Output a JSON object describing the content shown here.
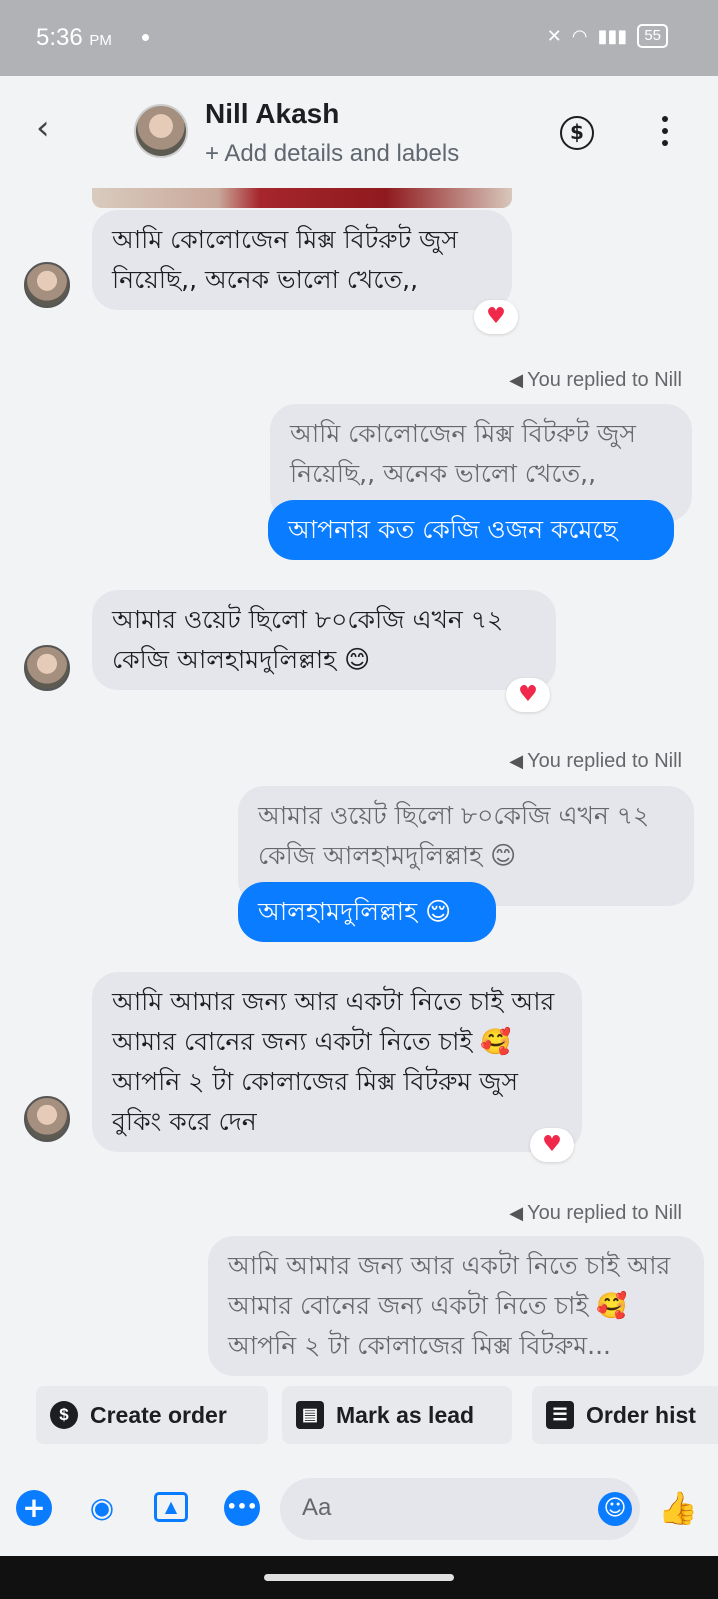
{
  "status_bar": {
    "time": "5:36",
    "ampm": "PM",
    "battery": "55"
  },
  "header": {
    "name": "Nill Akash",
    "subtitle": "+ Add details and labels"
  },
  "messages": [
    {
      "text": "আমি কোলোজেন মিক্স বিটরুট জুস নিয়েছি,, অনেক ভালো খেতে,,"
    },
    {
      "replied": "You replied to Nill",
      "quote": "আমি কোলোজেন মিক্স বিটরুট জুস নিয়েছি,, অনেক ভালো খেতে,,",
      "reply": "আপনার কত কেজি ওজন কমেছে"
    },
    {
      "text": "আমার ওয়েট ছিলো ৮০কেজি এখন ৭২ কেজি আলহামদুলিল্লাহ 😊"
    },
    {
      "replied": "You replied to Nill",
      "quote": "আমার ওয়েট ছিলো ৮০কেজি এখন ৭২ কেজি আলহামদুলিল্লাহ 😊",
      "reply": "আলহামদুলিল্লাহ 😌"
    },
    {
      "text": "আমি আমার জন্য আর একটা নিতে চাই আর আমার বোনের জন্য একটা নিতে চাই 🥰 আপনি ২ টা কোলাজের মিক্স বিটরুম জুস বুকিং করে দেন"
    },
    {
      "replied": "You replied to Nill",
      "quote": "আমি আমার জন্য আর একটা নিতে চাই আর আমার বোনের জন্য একটা নিতে চাই 🥰 আপনি ২ টা কোলাজের মিক্স বিটরুম..."
    }
  ],
  "reaction": "♥",
  "actions": [
    {
      "label": "Create order",
      "icon": "dollar-icon"
    },
    {
      "label": "Mark as lead",
      "icon": "contact-card-icon"
    },
    {
      "label": "Order hist",
      "icon": "list-icon"
    }
  ],
  "composer": {
    "placeholder": "Aa"
  }
}
